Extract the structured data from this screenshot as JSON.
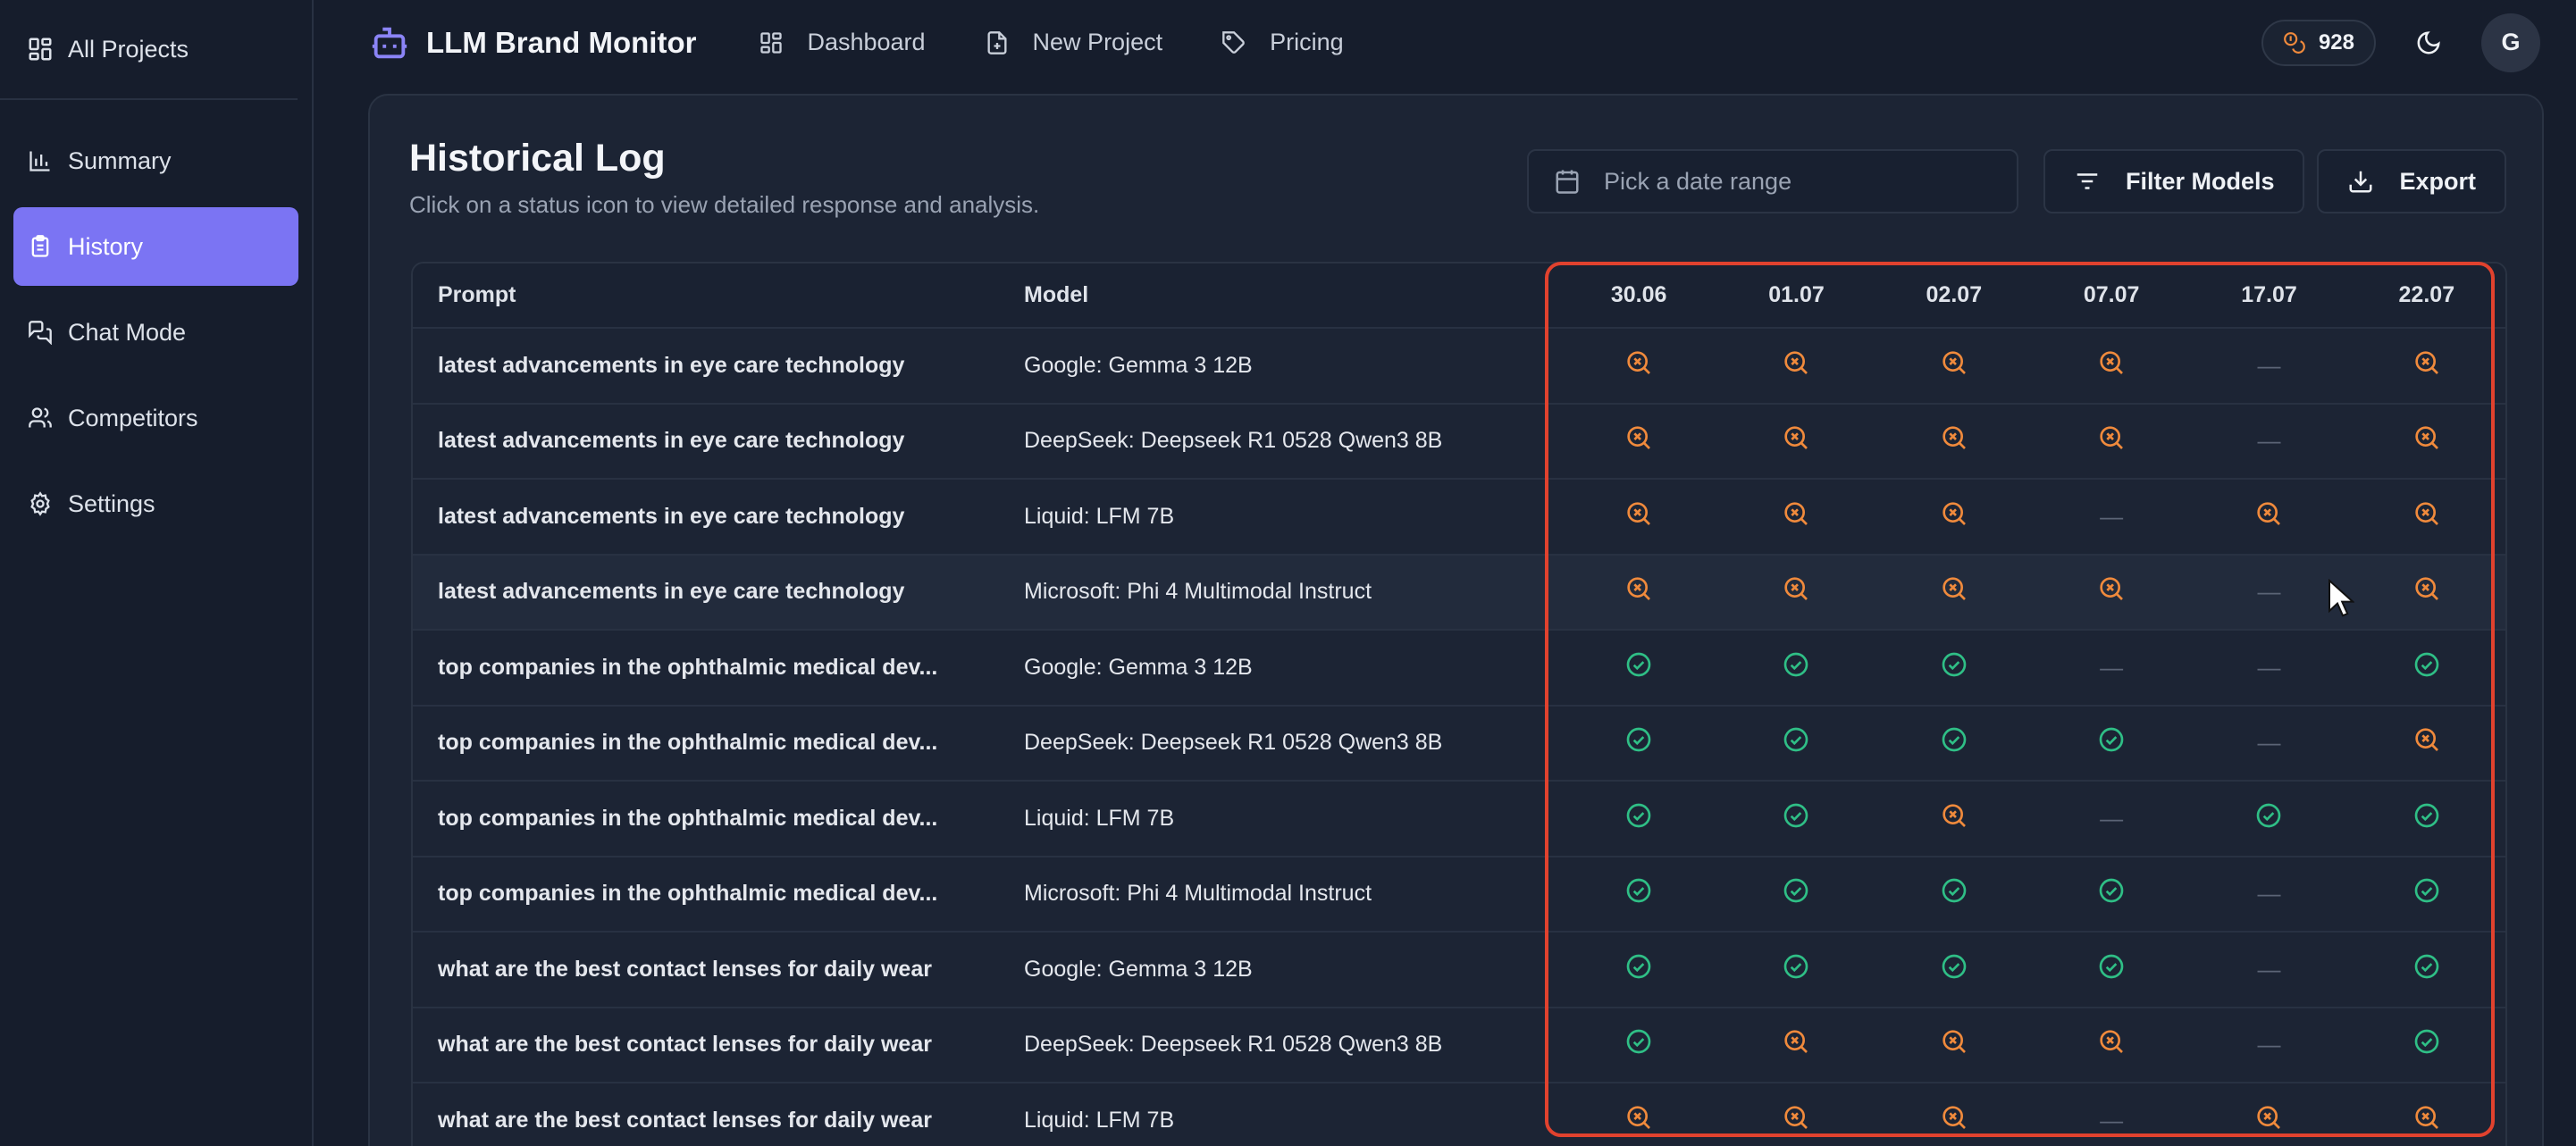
{
  "sidebar": {
    "top": {
      "label": "All Projects"
    },
    "items": [
      {
        "label": "Summary",
        "icon": "bar-chart-icon"
      },
      {
        "label": "History",
        "icon": "clipboard-icon",
        "active": true
      },
      {
        "label": "Chat Mode",
        "icon": "chat-icon"
      },
      {
        "label": "Competitors",
        "icon": "users-icon"
      },
      {
        "label": "Settings",
        "icon": "gear-icon"
      }
    ]
  },
  "header": {
    "brand": "LLM Brand Monitor",
    "nav": [
      {
        "label": "Dashboard",
        "icon": "grid-icon"
      },
      {
        "label": "New Project",
        "icon": "file-plus-icon"
      },
      {
        "label": "Pricing",
        "icon": "tag-icon"
      }
    ],
    "credits": "928",
    "avatar": "G"
  },
  "page": {
    "title": "Historical Log",
    "subtitle": "Click on a status icon to view detailed response and analysis.",
    "date_placeholder": "Pick a date range",
    "filter_label": "Filter Models",
    "export_label": "Export"
  },
  "table": {
    "headers": {
      "prompt": "Prompt",
      "model": "Model"
    },
    "dates": [
      "30.06",
      "01.07",
      "02.07",
      "07.07",
      "17.07",
      "22.07"
    ],
    "rows": [
      {
        "prompt": "latest advancements in eye care technology",
        "model": "Google: Gemma 3 12B",
        "statuses": [
          "fail",
          "fail",
          "fail",
          "fail",
          "none",
          "fail"
        ]
      },
      {
        "prompt": "latest advancements in eye care technology",
        "model": "DeepSeek: Deepseek R1 0528 Qwen3 8B",
        "statuses": [
          "fail",
          "fail",
          "fail",
          "fail",
          "none",
          "fail"
        ]
      },
      {
        "prompt": "latest advancements in eye care technology",
        "model": "Liquid: LFM 7B",
        "statuses": [
          "fail",
          "fail",
          "fail",
          "none",
          "fail",
          "fail"
        ]
      },
      {
        "prompt": "latest advancements in eye care technology",
        "model": "Microsoft: Phi 4 Multimodal Instruct",
        "statuses": [
          "fail",
          "fail",
          "fail",
          "fail",
          "none",
          "fail"
        ]
      },
      {
        "prompt": "top companies in the ophthalmic medical dev...",
        "model": "Google: Gemma 3 12B",
        "statuses": [
          "ok",
          "ok",
          "ok",
          "none",
          "none",
          "ok"
        ]
      },
      {
        "prompt": "top companies in the ophthalmic medical dev...",
        "model": "DeepSeek: Deepseek R1 0528 Qwen3 8B",
        "statuses": [
          "ok",
          "ok",
          "ok",
          "ok",
          "none",
          "fail"
        ]
      },
      {
        "prompt": "top companies in the ophthalmic medical dev...",
        "model": "Liquid: LFM 7B",
        "statuses": [
          "ok",
          "ok",
          "fail",
          "none",
          "ok",
          "ok"
        ]
      },
      {
        "prompt": "top companies in the ophthalmic medical dev...",
        "model": "Microsoft: Phi 4 Multimodal Instruct",
        "statuses": [
          "ok",
          "ok",
          "ok",
          "ok",
          "none",
          "ok"
        ]
      },
      {
        "prompt": "what are the best contact lenses for daily wear",
        "model": "Google: Gemma 3 12B",
        "statuses": [
          "ok",
          "ok",
          "ok",
          "ok",
          "none",
          "ok"
        ]
      },
      {
        "prompt": "what are the best contact lenses for daily wear",
        "model": "DeepSeek: Deepseek R1 0528 Qwen3 8B",
        "statuses": [
          "ok",
          "fail",
          "fail",
          "fail",
          "none",
          "ok"
        ]
      },
      {
        "prompt": "what are the best contact lenses for daily wear",
        "model": "Liquid: LFM 7B",
        "statuses": [
          "fail",
          "fail",
          "fail",
          "none",
          "fail",
          "fail"
        ]
      }
    ]
  },
  "colors": {
    "accent": "#7b74f3",
    "fail": "#f08a3c",
    "ok": "#2fbf86",
    "highlight": "#e1422e"
  }
}
